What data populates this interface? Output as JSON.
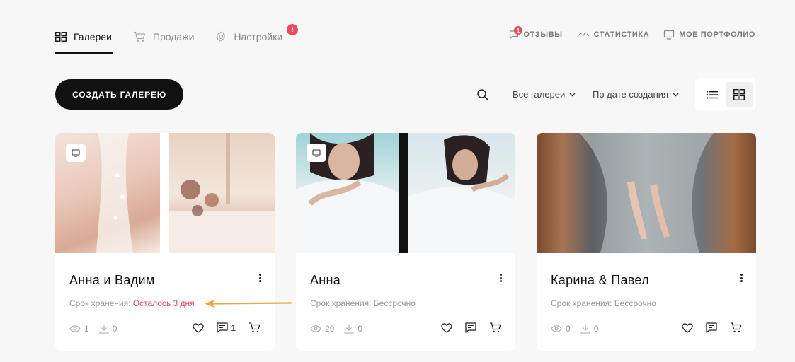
{
  "nav": {
    "tabs": [
      {
        "label": "Галереи",
        "icon": "grid-icon",
        "active": true
      },
      {
        "label": "Продажи",
        "icon": "cart-icon"
      },
      {
        "label": "Настройки",
        "icon": "gear-icon",
        "badge": "!"
      }
    ],
    "links": [
      {
        "label": "ОТЗЫВЫ",
        "icon": "chat-icon",
        "badge": "1"
      },
      {
        "label": "СТАТИСТИКА",
        "icon": "chart-line-icon"
      },
      {
        "label": "МОЕ ПОРТФОЛИО",
        "icon": "monitor-icon"
      }
    ]
  },
  "toolbar": {
    "create_label": "СОЗДАТЬ ГАЛЕРЕЮ",
    "filter_label": "Все галереи",
    "sort_label": "По дате создания"
  },
  "cards": [
    {
      "title": "Анна и Вадим",
      "storage_label": "Срок хранения:",
      "storage_value": "Осталось 3 дня",
      "views": "1",
      "downloads": "0",
      "comments": "1"
    },
    {
      "title": "Анна",
      "storage_label": "Срок хранения:",
      "storage_value": "Бессрочно",
      "views": "29",
      "downloads": "0",
      "comments": ""
    },
    {
      "title": "Карина & Павел",
      "storage_label": "Срок хранения:",
      "storage_value": "Бессрочно",
      "views": "0",
      "downloads": "0",
      "comments": ""
    }
  ],
  "colors": {
    "accent": "#111111",
    "badge": "#e84a5f",
    "expiring": "#e0485d",
    "annotation_arrow": "#e8a842"
  }
}
